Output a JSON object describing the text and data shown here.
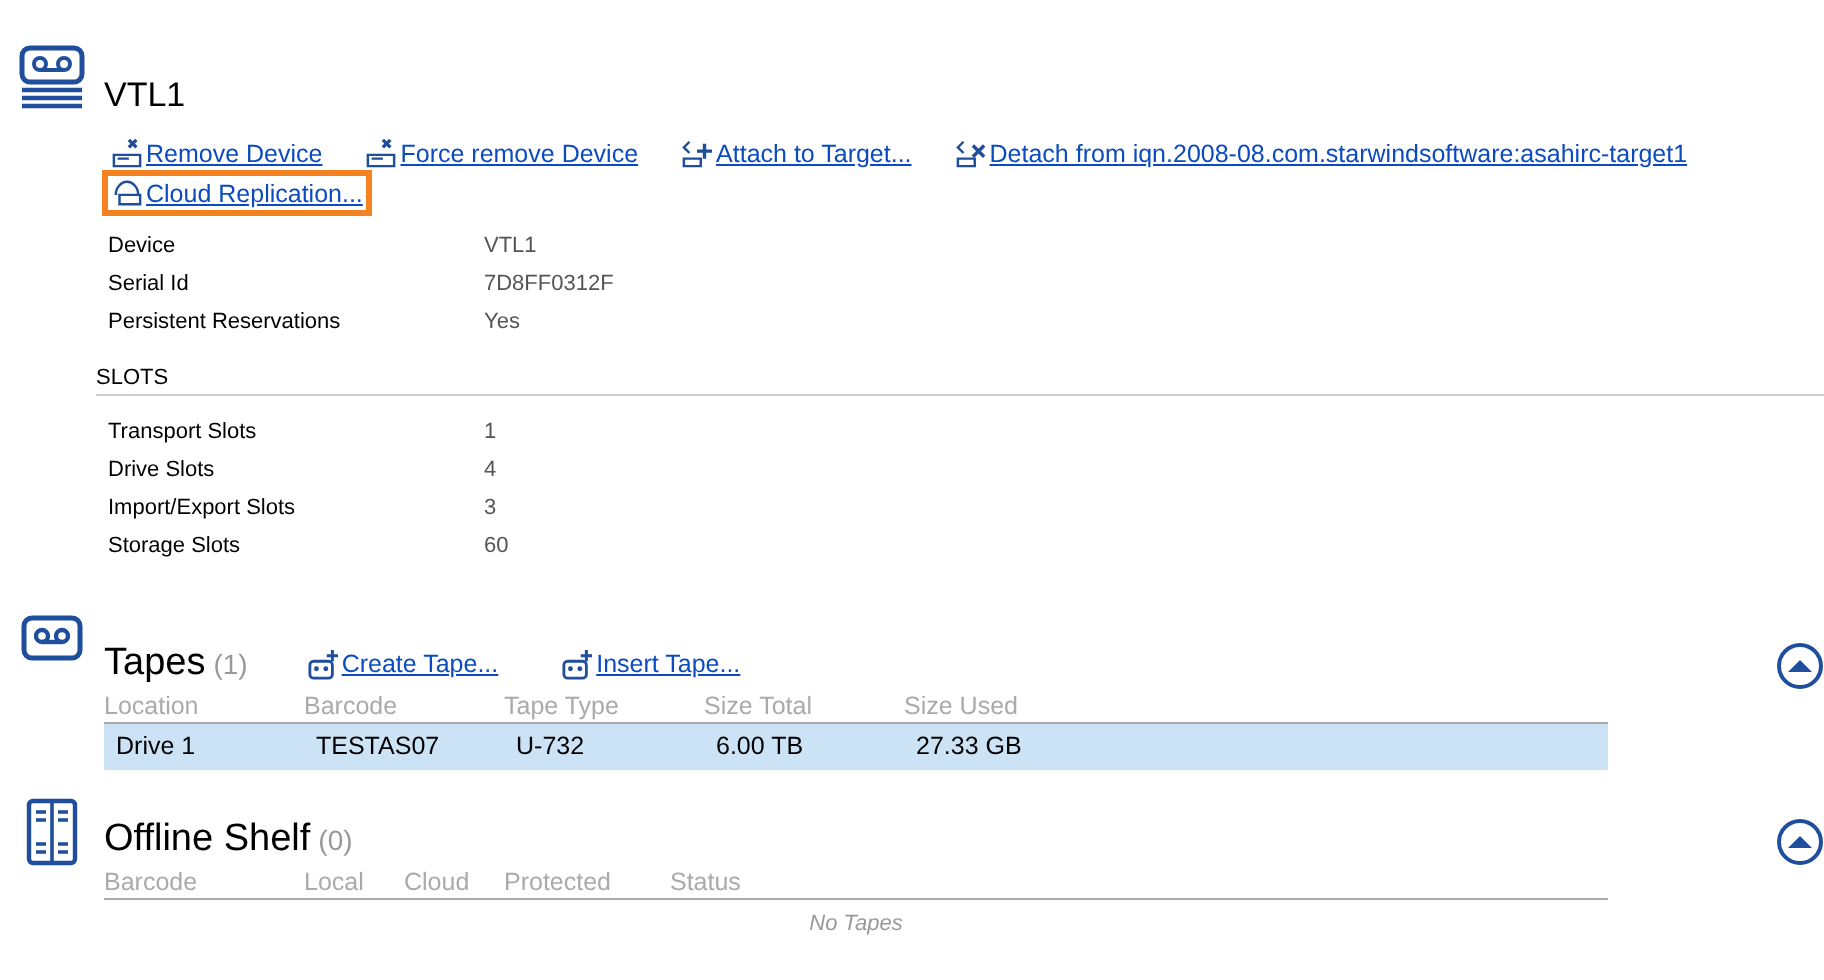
{
  "device": {
    "title": "VTL1",
    "actions": [
      {
        "label": "Remove Device",
        "kind": "remove",
        "highlighted": false
      },
      {
        "label": "Force remove Device",
        "kind": "remove",
        "highlighted": false
      },
      {
        "label": "Attach to Target...",
        "kind": "attach",
        "highlighted": false
      },
      {
        "label": "Detach from iqn.2008-08.com.starwindsoftware:asahirc-target1",
        "kind": "detach",
        "highlighted": false
      },
      {
        "label": "Cloud Replication...",
        "kind": "cloud",
        "highlighted": true
      }
    ],
    "properties": [
      {
        "label": "Device",
        "value": "VTL1"
      },
      {
        "label": "Serial Id",
        "value": "7D8FF0312F"
      },
      {
        "label": "Persistent Reservations",
        "value": "Yes"
      }
    ],
    "slots": {
      "title": "SLOTS",
      "properties": [
        {
          "label": "Transport Slots",
          "value": "1"
        },
        {
          "label": "Drive Slots",
          "value": "4"
        },
        {
          "label": "Import/Export Slots",
          "value": "3"
        },
        {
          "label": "Storage Slots",
          "value": "60"
        }
      ]
    }
  },
  "tapes": {
    "title": "Tapes",
    "count": "(1)",
    "actions": [
      "Create Tape...",
      "Insert Tape..."
    ],
    "expanded": true,
    "columns": [
      "Location",
      "Barcode",
      "Tape Type",
      "Size Total",
      "Size Used"
    ],
    "rows": [
      {
        "cells": [
          "Drive 1",
          "TESTAS07",
          "U-732",
          "6.00 TB",
          "27.33 GB"
        ],
        "selected": true
      }
    ]
  },
  "offline_shelf": {
    "title": "Offline Shelf",
    "count": "(0)",
    "expanded": true,
    "columns": [
      "Barcode",
      "Local",
      "Cloud",
      "Protected",
      "Status"
    ],
    "empty_text": "No Tapes"
  }
}
